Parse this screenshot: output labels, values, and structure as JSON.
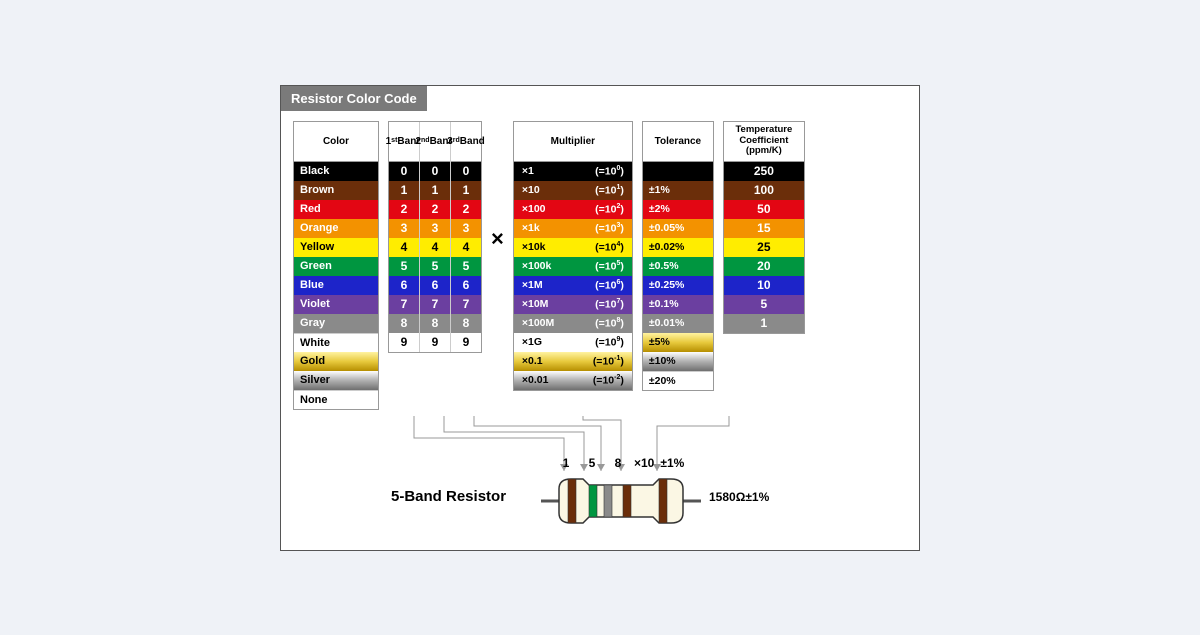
{
  "title": "Resistor Color Code",
  "headers": {
    "color": "Color",
    "band1": "1<sup>st</sup> Band",
    "band2": "2<sup>nd</sup> Band",
    "band3": "3<sup>rd</sup> Band",
    "mult": "Multiplier",
    "tol": "Tolerance",
    "temp": "Temperature Coefficient (ppm/K)"
  },
  "times": "×",
  "rows": [
    {
      "name": "Black",
      "bg": "#000000",
      "fg": "#ffffff",
      "d": "0",
      "mult": "×1",
      "exp": "(=10<sup>0</sup>)",
      "tol": "",
      "temp": "250"
    },
    {
      "name": "Brown",
      "bg": "#6b2e0a",
      "fg": "#ffffff",
      "d": "1",
      "mult": "×10",
      "exp": "(=10<sup>1</sup>)",
      "tol": "±1%",
      "temp": "100"
    },
    {
      "name": "Red",
      "bg": "#e30613",
      "fg": "#ffffff",
      "d": "2",
      "mult": "×100",
      "exp": "(=10<sup>2</sup>)",
      "tol": "±2%",
      "temp": "50"
    },
    {
      "name": "Orange",
      "bg": "#f39200",
      "fg": "#ffffff",
      "d": "3",
      "mult": "×1k",
      "exp": "(=10<sup>3</sup>)",
      "tol": "±0.05%",
      "temp": "15"
    },
    {
      "name": "Yellow",
      "bg": "#ffed00",
      "fg": "#000000",
      "d": "4",
      "mult": "×10k",
      "exp": "(=10<sup>4</sup>)",
      "tol": "±0.02%",
      "temp": "25"
    },
    {
      "name": "Green",
      "bg": "#009640",
      "fg": "#ffffff",
      "d": "5",
      "mult": "×100k",
      "exp": "(=10<sup>5</sup>)",
      "tol": "±0.5%",
      "temp": "20"
    },
    {
      "name": "Blue",
      "bg": "#1d24c9",
      "fg": "#ffffff",
      "d": "6",
      "mult": "×1M",
      "exp": "(=10<sup>6</sup>)",
      "tol": "±0.25%",
      "temp": "10"
    },
    {
      "name": "Violet",
      "bg": "#6b3fa0",
      "fg": "#ffffff",
      "d": "7",
      "mult": "×10M",
      "exp": "(=10<sup>7</sup>)",
      "tol": "±0.1%",
      "temp": "5"
    },
    {
      "name": "Gray",
      "bg": "#8a8a8a",
      "fg": "#ffffff",
      "d": "8",
      "mult": "×100M",
      "exp": "(=10<sup>8</sup>)",
      "tol": "±0.01%",
      "temp": "1"
    },
    {
      "name": "White",
      "bg": "#ffffff",
      "fg": "#000000",
      "d": "9",
      "mult": "×1G",
      "exp": "(=10<sup>9</sup>)",
      "tol": null,
      "temp": null
    },
    {
      "name": "Gold",
      "bg": "gold",
      "fg": "#000000",
      "d": null,
      "mult": "×0.1",
      "exp": "(=10<sup>-1</sup>)",
      "tol": "±5%",
      "temp": null
    },
    {
      "name": "Silver",
      "bg": "silver",
      "fg": "#000000",
      "d": null,
      "mult": "×0.01",
      "exp": "(=10<sup>-2</sup>)",
      "tol": "±10%",
      "temp": null
    },
    {
      "name": "None",
      "bg": "#ffffff",
      "fg": "#000000",
      "d": null,
      "mult": null,
      "exp": null,
      "tol": "±20%",
      "temp": null
    }
  ],
  "example": {
    "label": "5-Band Resistor",
    "annot": [
      "1",
      "5",
      "8",
      "×10",
      "±1%"
    ],
    "value": "1580Ω±1%",
    "bands": [
      {
        "color": "#6b2e0a"
      },
      {
        "color": "#009640"
      },
      {
        "color": "#8a8a8a"
      },
      {
        "color": "#6b2e0a"
      },
      {
        "color": "#6b2e0a"
      }
    ]
  }
}
